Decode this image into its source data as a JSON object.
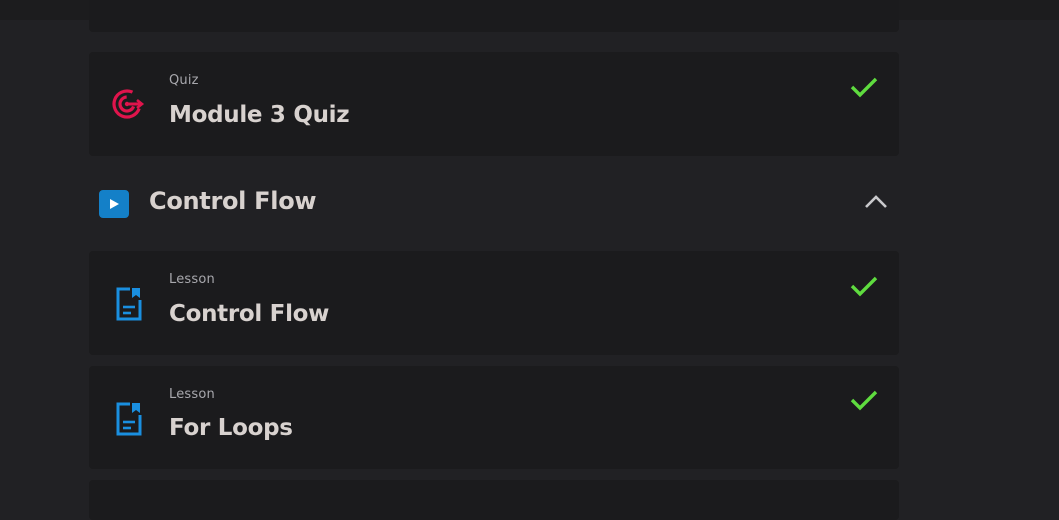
{
  "modules": [
    {
      "kind": "card",
      "type_label": "Quiz",
      "title": "Module 3 Quiz",
      "icon": "target-icon",
      "completed": true
    }
  ],
  "section": {
    "title": "Control Flow",
    "icon": "play-icon",
    "expanded": true,
    "items": [
      {
        "type_label": "Lesson",
        "title": "Control Flow",
        "icon": "document-icon",
        "completed": true
      },
      {
        "type_label": "Lesson",
        "title": "For Loops",
        "icon": "document-icon",
        "completed": true
      }
    ]
  },
  "colors": {
    "background": "#212124",
    "card": "#1b1b1d",
    "quiz_icon": "#e0144c",
    "lesson_icon": "#1a8fe0",
    "play_badge": "#1480c8",
    "check": "#5fdc3f",
    "title_text": "#d8d2cf",
    "label_text": "#a8a8ad"
  }
}
